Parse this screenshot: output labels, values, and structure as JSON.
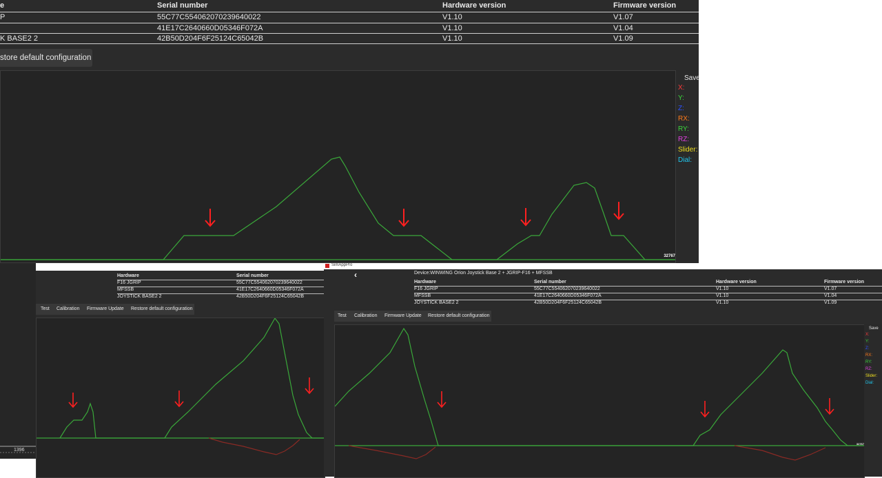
{
  "app": {
    "title": "SimAppPro"
  },
  "device_label": "Device:WINWING Orion Joystick Base 2 + JGRIP-F16 + MFSSB",
  "table": {
    "headers": {
      "hardware": "Hardware",
      "serial": "Serial number",
      "hw_version": "Hardware version",
      "fw_version": "Firmware version"
    },
    "rows": [
      {
        "hardware": "F16 JGRIP",
        "serial": "55C77C554062070239640022",
        "hw_version": "V1.10",
        "fw_version": "V1.07"
      },
      {
        "hardware": "MFSSB",
        "serial": "41E17C2640660D05346F072A",
        "hw_version": "V1.10",
        "fw_version": "V1.04"
      },
      {
        "hardware": "JOYSTICK BASE2 2",
        "serial": "42B50D204F6F25124C65042B",
        "hw_version": "V1.10",
        "fw_version": "V1.09"
      }
    ]
  },
  "top_crop": {
    "header_hardware": "e",
    "row_hardware": [
      "P",
      "",
      "K BASE2 2"
    ],
    "button_label": "store default configuration"
  },
  "tabs": {
    "test": "Test",
    "calibration": "Calibration",
    "firmware_update": "Firmware Update",
    "restore": "Restore default configuration"
  },
  "legend": {
    "save": "Save",
    "save_partial": "Save",
    "items": [
      {
        "label": "X:",
        "color": "#ff3b3b"
      },
      {
        "label": "Y:",
        "color": "#3bd43b"
      },
      {
        "label": "Z:",
        "color": "#2b50ff"
      },
      {
        "label": "RX:",
        "color": "#ff7a1a"
      },
      {
        "label": "RY:",
        "color": "#3bd43b"
      },
      {
        "label": "RZ:",
        "color": "#e040e0"
      },
      {
        "label": "Slider:",
        "color": "#f0e020"
      },
      {
        "label": "Dial:",
        "color": "#20c8f0"
      }
    ]
  },
  "axis_labels": {
    "top_right": "32767",
    "bottom_left": "1396",
    "bottom_right": "32767"
  },
  "colors": {
    "trace_green": "#3aa83a",
    "trace_red": "#8a2a24",
    "arrow_red": "#ff2020",
    "panel_bg": "#242424"
  }
}
